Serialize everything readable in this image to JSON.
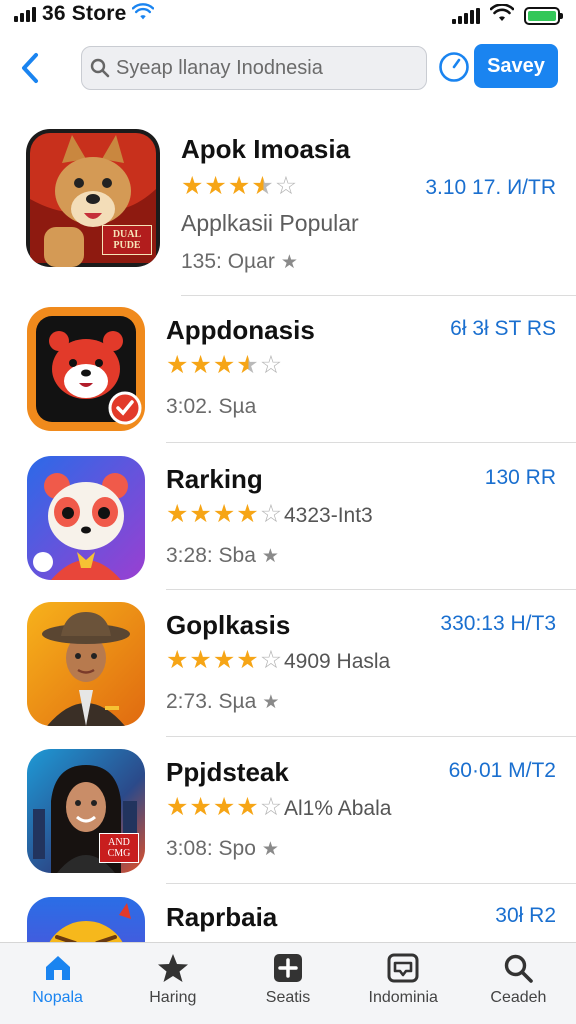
{
  "status_bar": {
    "carrier": "36 Store",
    "icons": [
      "cellular-signal-icon",
      "wifi-icon",
      "battery-icon"
    ]
  },
  "nav": {
    "back_icon": "chevron-left-icon",
    "search_placeholder": "Syeap llanay Inodnesia",
    "clock_icon": "clock-icon",
    "save_label": "Savey"
  },
  "apps": [
    {
      "name": "Apok Imoasia",
      "rating": 3.5,
      "category": "Applkasii Popular",
      "meta": "135: Oµar",
      "price": "3.10 17. И/TR",
      "icon_name": "shiba-dog-app-icon",
      "icon_badge": "DUAL PUDE"
    },
    {
      "name": "Appdonasis",
      "rating": 3.5,
      "meta": "3:02. Sµa",
      "price": "6ł 3ł ST RS",
      "icon_name": "red-panda-app-icon"
    },
    {
      "name": "Rarking",
      "rating": 4,
      "rating_text": "4323-Int3",
      "meta": "3:28: Sba",
      "price": "130 RR",
      "icon_name": "panda-mascot-app-icon"
    },
    {
      "name": "Goplkasis",
      "rating": 4,
      "rating_text": "4909 Hasla",
      "meta": "2:73. Sµa",
      "price": "330:13 H/T3",
      "icon_name": "man-in-hat-app-icon"
    },
    {
      "name": "Ppjdsteak",
      "rating": 4,
      "rating_text": "Al1% Abala",
      "meta": "3:08: Spo",
      "price": "60·01 M/T2",
      "icon_name": "woman-portrait-app-icon",
      "icon_badge": "AND CMG"
    },
    {
      "name": "Raprbaia",
      "price": "30ł R2",
      "icon_name": "emoji-character-app-icon"
    }
  ],
  "tabs": [
    {
      "label": "Nopala",
      "icon": "home-icon",
      "active": true
    },
    {
      "label": "Haring",
      "icon": "star-icon",
      "active": false
    },
    {
      "label": "Seatis",
      "icon": "plus-square-icon",
      "active": false
    },
    {
      "label": "Indominia",
      "icon": "inbox-icon",
      "active": false
    },
    {
      "label": "Ceadeh",
      "icon": "search-icon",
      "active": false
    }
  ],
  "colors": {
    "accent": "#1a84f0",
    "price_blue": "#1a6fcf",
    "star_gold": "#f6a516",
    "tab_bar_bg": "#f4f5f7"
  }
}
